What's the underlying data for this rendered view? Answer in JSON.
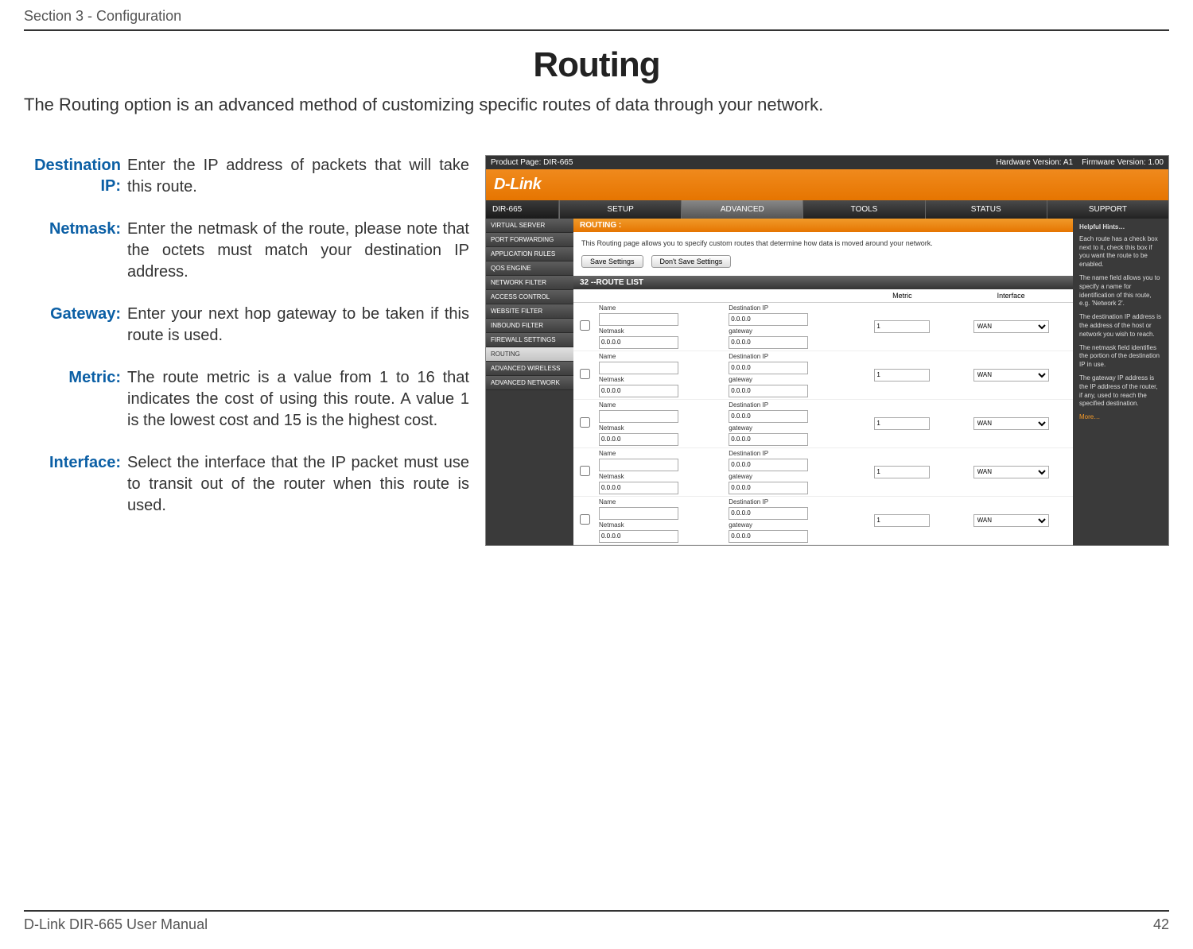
{
  "header": {
    "section": "Section 3 - Configuration"
  },
  "title": "Routing",
  "intro": "The Routing option is an advanced method of customizing specific routes of data through your network.",
  "defs": [
    {
      "label": "Destination IP:",
      "text": "Enter the IP address of packets that will take this route."
    },
    {
      "label": "Netmask:",
      "text": "Enter the netmask of the route, please note that the octets must match your destination IP address."
    },
    {
      "label": "Gateway:",
      "text": "Enter your next hop gateway to be taken if this route is used."
    },
    {
      "label": "Metric:",
      "text": "The route metric is a value from 1 to 16 that indicates the cost of using this route. A value 1 is the lowest cost and 15 is the highest cost."
    },
    {
      "label": "Interface:",
      "text": "Select the interface that the IP packet must use to transit out of the router when this route is used."
    }
  ],
  "screenshot": {
    "topbar": {
      "product": "Product Page: DIR-665",
      "hw": "Hardware Version: A1",
      "fw": "Firmware Version: 1.00"
    },
    "brand": "D-Link",
    "model": "DIR-665",
    "tabs": [
      "SETUP",
      "ADVANCED",
      "TOOLS",
      "STATUS",
      "SUPPORT"
    ],
    "active_tab": 1,
    "side_items": [
      "VIRTUAL SERVER",
      "PORT FORWARDING",
      "APPLICATION RULES",
      "QOS ENGINE",
      "NETWORK FILTER",
      "ACCESS CONTROL",
      "WEBSITE FILTER",
      "INBOUND FILTER",
      "FIREWALL SETTINGS",
      "ROUTING",
      "ADVANCED WIRELESS",
      "ADVANCED NETWORK"
    ],
    "active_side": 9,
    "section_title": "ROUTING :",
    "section_desc": "This Routing page allows you to specify custom routes that determine how data is moved around your network.",
    "save_btn": "Save Settings",
    "dont_save_btn": "Don't Save Settings",
    "routelist_title": "32 --ROUTE LIST",
    "table": {
      "headers": {
        "metric": "Metric",
        "interface": "Interface"
      },
      "labels": {
        "name": "Name",
        "dest": "Destination IP",
        "netmask": "Netmask",
        "gateway": "gateway"
      },
      "default_ip": "0.0.0.0",
      "metric_default": "1",
      "iface_default": "WAN",
      "row_count": 5
    },
    "hints": {
      "title": "Helpful Hints…",
      "p1": "Each route has a check box next to it, check this box if you want the route to be enabled.",
      "p2": "The name field allows you to specify a name for identification of this route, e.g. 'Network 2'.",
      "p3": "The destination IP address is the address of the host or network you wish to reach.",
      "p4": "The netmask field identifies the portion of the destination IP in use.",
      "p5": "The gateway IP address is the IP address of the router, if any, used to reach the specified destination.",
      "more": "More…"
    }
  },
  "footer": {
    "left": "D-Link DIR-665 User Manual",
    "right": "42"
  }
}
